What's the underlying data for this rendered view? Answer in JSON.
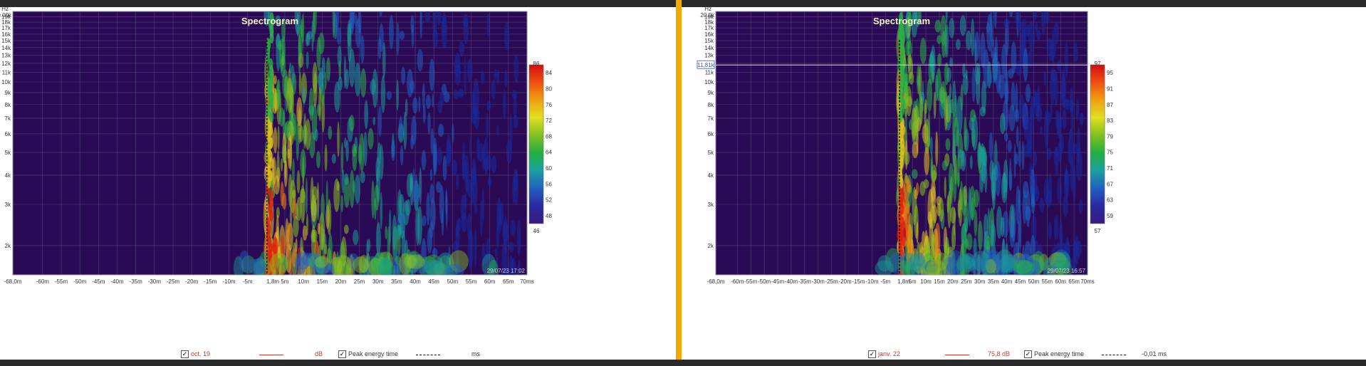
{
  "colors": {
    "plot_bg": "#2a0a55",
    "grid": "#6a6a8a",
    "divider": "#f2a900",
    "red": "#c0392b"
  },
  "chart_data": [
    {
      "type": "heatmap",
      "title": "Spectrogram",
      "y_unit": "Hz",
      "y_top_label": "20.00k",
      "y_ticks": [
        "19k",
        "18k",
        "17k",
        "16k",
        "15k",
        "14k",
        "13k",
        "12k",
        "11k",
        "10k",
        "9k",
        "8k",
        "7k",
        "6k",
        "5k",
        "4k",
        "3k",
        "2k"
      ],
      "x_ticks": [
        "-68,0m",
        "-60m",
        "-55m",
        "-50m",
        "-45m",
        "-40m",
        "-35m",
        "-30m",
        "-25m",
        "-20m",
        "-15m",
        "-10m",
        "-5m",
        "1,8m",
        "5m",
        "10m",
        "15m",
        "20m",
        "25m",
        "30m",
        "35m",
        "40m",
        "45m",
        "50m",
        "55m",
        "60m",
        "65m",
        "70ms"
      ],
      "x_range_ms": [
        -68,
        70
      ],
      "y_range_hz": [
        1500,
        20000
      ],
      "y_scale": "log",
      "scale_labels": [
        "86",
        "84",
        "80",
        "76",
        "72",
        "68",
        "64",
        "60",
        "56",
        "52",
        "48",
        "46"
      ],
      "scale_range_db": [
        46,
        86
      ],
      "timestamp": "29/07/23 17:02",
      "legend": {
        "item1_label": "oct. 19",
        "item1_value": "dB",
        "item2_label": "Peak energy time",
        "item2_value": "ms"
      }
    },
    {
      "type": "heatmap",
      "title": "Spectrogram",
      "y_unit": "Hz",
      "y_top_label": "20.0k",
      "y_ticks": [
        "19k",
        "18k",
        "17k",
        "16k",
        "15k",
        "14k",
        "13k",
        "12k",
        "11k",
        "10k",
        "9k",
        "8k",
        "7k",
        "6k",
        "5k",
        "4k",
        "3k",
        "2k"
      ],
      "cursor_label": "11,81k",
      "cursor_hz": 11810,
      "x_ticks": [
        "-68,0m",
        "-60m",
        "-55m",
        "-50m",
        "-45m",
        "-40m",
        "-35m",
        "-30m",
        "-25m",
        "-20m",
        "-15m",
        "-10m",
        "-5m",
        "1,8m",
        "5m",
        "10m",
        "15m",
        "20m",
        "25m",
        "30m",
        "35m",
        "40m",
        "45m",
        "50m",
        "55m",
        "60m",
        "65m",
        "70ms"
      ],
      "x_range_ms": [
        -68,
        70
      ],
      "y_range_hz": [
        1500,
        20000
      ],
      "y_scale": "log",
      "scale_labels": [
        "97",
        "95",
        "91",
        "87",
        "83",
        "79",
        "75",
        "71",
        "67",
        "63",
        "59",
        "57"
      ],
      "scale_range_db": [
        57,
        97
      ],
      "timestamp": "29/07/23 16:57",
      "legend": {
        "item1_label": "janv. 22",
        "item1_value": "75,8 dB",
        "item2_label": "Peak energy time",
        "item2_value": "-0,01 ms"
      }
    }
  ]
}
